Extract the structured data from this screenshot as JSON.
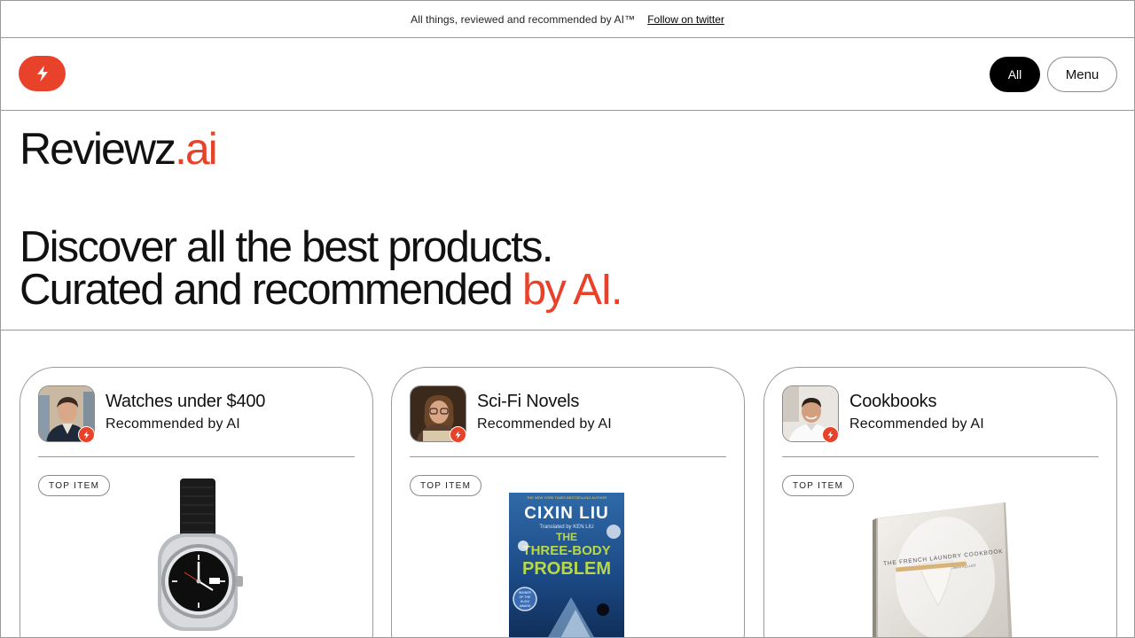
{
  "announcement": {
    "tagline": "All things, reviewed and recommended by AI™",
    "link": "Follow on twitter"
  },
  "header": {
    "logo_icon": "bolt-icon",
    "nav": {
      "all_label": "All",
      "menu_label": "Menu"
    }
  },
  "hero": {
    "brand_name": "Reviewz",
    "brand_tld": ".ai",
    "headline_line1": "Discover all the best products.",
    "headline_line2_plain": "Curated and recommended ",
    "headline_line2_accent": "by AI."
  },
  "colors": {
    "accent": "#e8432a",
    "text": "#111111",
    "border": "#9a9a9a"
  },
  "cards": [
    {
      "title": "Watches under $400",
      "subtitle": "Recommended by AI",
      "badge": "TOP ITEM",
      "product_image": "wristwatch"
    },
    {
      "title": "Sci-Fi Novels",
      "subtitle": "Recommended by AI",
      "badge": "TOP ITEM",
      "product_image": "book-cover",
      "book": {
        "banner": "THE NEW YORK TIMES BESTSELLING AUTHOR",
        "author": "CIXIN LIU",
        "translator": "Translated by KEN LIU",
        "title_line1": "THE",
        "title_line2": "THREE-BODY",
        "title_line3": "PROBLEM",
        "award_line1": "WINNER",
        "award_line2": "OF THE",
        "award_line3": "HUGO",
        "award_line4": "AWARD"
      }
    },
    {
      "title": "Cookbooks",
      "subtitle": "Recommended by AI",
      "badge": "TOP ITEM",
      "product_image": "cookbook",
      "book": {
        "title": "THE FRENCH LAUNDRY COOKBOOK",
        "author": "THOMAS KELLER"
      }
    }
  ]
}
